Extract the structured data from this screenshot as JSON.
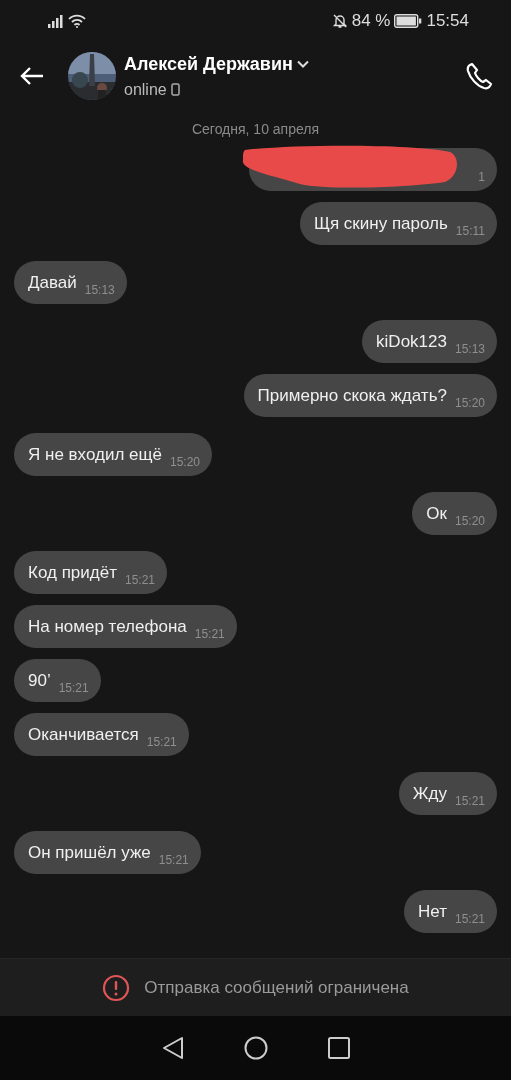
{
  "status_bar": {
    "battery_text": "84 %",
    "time": "15:54"
  },
  "header": {
    "name": "Алексей Державин",
    "presence": "online"
  },
  "date_divider": "Сегодня, 10 апреля",
  "messages": [
    {
      "kind": "outgoing",
      "redacted": true,
      "time": "1"
    },
    {
      "kind": "outgoing",
      "text": "Щя скину пароль",
      "time": "15:11"
    },
    {
      "kind": "incoming",
      "text": "Давай",
      "time": "15:13"
    },
    {
      "kind": "outgoing",
      "text": "kiDok123",
      "time": "15:13"
    },
    {
      "kind": "outgoing",
      "text": "Примерно скока ждать?",
      "time": "15:20"
    },
    {
      "kind": "incoming",
      "text": "Я не входил ещё",
      "time": "15:20"
    },
    {
      "kind": "outgoing",
      "text": "Ок",
      "time": "15:20"
    },
    {
      "kind": "incoming",
      "text": "Код придёт",
      "time": "15:21"
    },
    {
      "kind": "incoming",
      "text": "На номер телефона",
      "time": "15:21"
    },
    {
      "kind": "incoming",
      "text": "90’",
      "time": "15:21"
    },
    {
      "kind": "incoming",
      "text": "Оканчивается",
      "time": "15:21"
    },
    {
      "kind": "outgoing",
      "text": "Жду",
      "time": "15:21"
    },
    {
      "kind": "incoming",
      "text": "Он пришёл уже",
      "time": "15:21"
    },
    {
      "kind": "outgoing",
      "text": "Нет",
      "time": "15:21"
    }
  ],
  "restriction_notice": "Отправка сообщений ограничена"
}
